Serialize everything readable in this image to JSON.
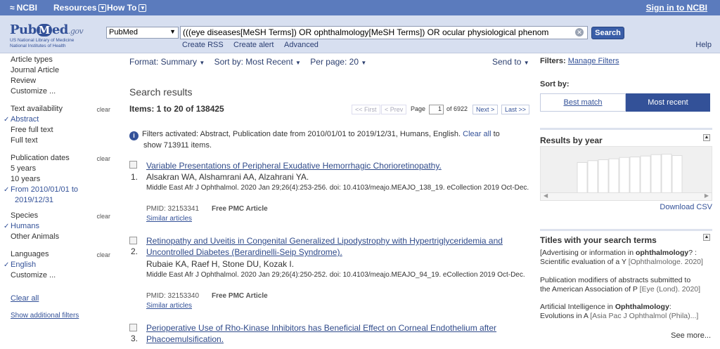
{
  "topbar": {
    "ncbi_label": "NCBI",
    "resources_label": "Resources",
    "howto_label": "How To",
    "signin_label": "Sign in to NCBI"
  },
  "header": {
    "logo_pub": "Pub",
    "logo_m": "M",
    "logo_ed": "ed",
    "logo_gov": ".gov",
    "logo_tagline_1": "US National Library of Medicine",
    "logo_tagline_2": "National Institutes of Health",
    "database_selected": "PubMed",
    "search_query": "(((eye diseases[MeSH Terms]) OR ophthalmology[MeSH Terms]) OR ocular physiological phenom",
    "search_button": "Search",
    "create_rss": "Create RSS",
    "create_alert": "Create alert",
    "advanced": "Advanced",
    "help": "Help"
  },
  "sidebar": {
    "article_types": {
      "heading": "Article types",
      "items": [
        "Journal Article",
        "Review",
        "Customize ..."
      ]
    },
    "text_availability": {
      "heading": "Text availability",
      "clear": "clear",
      "items": [
        "Abstract",
        "Free full text",
        "Full text"
      ]
    },
    "publication_dates": {
      "heading": "Publication dates",
      "clear": "clear",
      "items": [
        "5 years",
        "10 years",
        "From 2010/01/01 to",
        "2019/12/31"
      ]
    },
    "species": {
      "heading": "Species",
      "clear": "clear",
      "items": [
        "Humans",
        "Other Animals"
      ]
    },
    "languages": {
      "heading": "Languages",
      "clear": "clear",
      "items": [
        "English",
        "Customize ..."
      ]
    },
    "clear_all": "Clear all",
    "show_additional": "Show additional filters"
  },
  "toolbar": {
    "format": "Format: Summary",
    "sort": "Sort by: Most Recent",
    "per_page": "Per page: 20",
    "send_to": "Send to"
  },
  "results": {
    "title": "Search results",
    "count": "Items: 1 to 20 of 138425",
    "pager": {
      "first": "<< First",
      "prev": "< Prev",
      "page_label": "Page",
      "page_value": "1",
      "of_pages": "of 6922",
      "next": "Next >",
      "last": "Last >>"
    },
    "filters_note_main": "Filters activated: Abstract, Publication date from 2010/01/01 to 2019/12/31, Humans, English.",
    "filters_clear_all": "Clear all",
    "filters_note_to": "to",
    "filters_note_show": "show 713911 items.",
    "items": [
      {
        "num": "1.",
        "title": "Variable Presentations of Peripheral Exudative Hemorrhagic Chorioretinopathy.",
        "authors": "Alsakran WA, Alshamrani AA, Alzahrani YA.",
        "journal": "Middle East Afr J Ophthalmol. 2020 Jan 29;26(4):253-256. doi: 10.4103/meajo.MEAJO_138_19. eCollection 2019 Oct-Dec.",
        "pmid": "PMID: 32153341",
        "pmc": "Free PMC Article",
        "similar": "Similar articles"
      },
      {
        "num": "2.",
        "title_line1": "Retinopathy and Uveitis in Congenital Generalized Lipodystrophy with Hypertriglyceridemia and",
        "title_line2": "Uncontrolled Diabetes (Berardinelli-Seip Syndrome).",
        "authors": "Rubaie KA, Raef H, Stone DU, Kozak I.",
        "journal": "Middle East Afr J Ophthalmol. 2020 Jan 29;26(4):250-252. doi: 10.4103/meajo.MEAJO_94_19. eCollection 2019 Oct-Dec.",
        "pmid": "PMID: 32153340",
        "pmc": "Free PMC Article",
        "similar": "Similar articles"
      },
      {
        "num": "3.",
        "title_line1": "Perioperative Use of Rho-Kinase Inhibitors has Beneficial Effect on Corneal Endothelium after",
        "title_line2": "Phacoemulsification."
      }
    ]
  },
  "right": {
    "filters_label": "Filters:",
    "manage_filters": "Manage Filters",
    "sort_by_label": "Sort by:",
    "best_match": "Best match",
    "most_recent": "Most recent",
    "results_by_year": "Results by year",
    "download_csv": "Download CSV",
    "titles_heading": "Titles with your search terms",
    "title_items": [
      {
        "pre": "[Advertising or information in ",
        "bold": "ophthalmology",
        "post": "? :",
        "line2": "Scientific evaluation of a Y",
        "src": "[Ophthalmologe. 2020]"
      },
      {
        "pre": "Publication modifiers of abstracts submitted to",
        "bold": "",
        "post": "",
        "line2": "the American Association of P",
        "src": "[Eye (Lond). 2020]"
      },
      {
        "pre": "Artificial Intelligence in ",
        "bold": "Ophthalmology",
        "post": ":",
        "line2": "Evolutions in A",
        "src": "[Asia Pac J Ophthalmol (Phila)...]"
      }
    ],
    "see_more": "See more..."
  },
  "chart_data": {
    "type": "bar",
    "title": "Results by year",
    "values": [
      0,
      0,
      0,
      0,
      0,
      0,
      0,
      0,
      0,
      0,
      0,
      0,
      0,
      0,
      0,
      0,
      0,
      0,
      0,
      0,
      0,
      0,
      0,
      0,
      0,
      0,
      0,
      0,
      0,
      0,
      0,
      0,
      0,
      0,
      0,
      0,
      0,
      0,
      0,
      0,
      0,
      0,
      0,
      0,
      0,
      0,
      0,
      0,
      0,
      0,
      0,
      0,
      0,
      0,
      0,
      0,
      0,
      0,
      0,
      0,
      0,
      0,
      0,
      0,
      0,
      0,
      0,
      0,
      0,
      0,
      0,
      0,
      0,
      0,
      0,
      0,
      0,
      0,
      0,
      0,
      0,
      0,
      0,
      0,
      0,
      0,
      0,
      0,
      0,
      0,
      0,
      0,
      0,
      0,
      0,
      0,
      0,
      0,
      0,
      0,
      0,
      0,
      0,
      0,
      0,
      0,
      0,
      0,
      0,
      0,
      0,
      0,
      0,
      0,
      0,
      0,
      0,
      0,
      0,
      0,
      0,
      0,
      0,
      0,
      0,
      0,
      0,
      0,
      0,
      0,
      0,
      0,
      0,
      0,
      0,
      0,
      0,
      0,
      0,
      0,
      0,
      0,
      0,
      0,
      0,
      0,
      0,
      0,
      0,
      0,
      0,
      0,
      0,
      0,
      0,
      0,
      0,
      0,
      0,
      0,
      0,
      0,
      0,
      0,
      0,
      0,
      0,
      0,
      0,
      0,
      0,
      0,
      0,
      0,
      0,
      0,
      0,
      0,
      0,
      0,
      0,
      0,
      0,
      0,
      0,
      0,
      0,
      0,
      0,
      0,
      0,
      0,
      0,
      0,
      0,
      0,
      0,
      0,
      0,
      0
    ],
    "highlight": [
      0.0,
      0.0,
      0.0,
      0.0,
      0.0,
      0.0,
      0.0,
      0.0,
      0.0,
      0.0,
      0.0,
      0.0,
      0.0,
      0.0,
      0.0,
      0.0,
      0.0,
      0.0,
      0.0,
      0.0,
      0.0,
      0.0,
      0.0,
      0.0,
      0.0,
      0.0,
      0.0,
      0.0,
      0.0,
      0.0,
      0.0,
      0.0,
      0.0,
      0.0,
      0.0,
      0.0,
      0.0,
      0.0,
      0.0,
      0.0
    ],
    "bar_fractions": [
      0.66,
      0.7,
      0.72,
      0.74,
      0.77,
      0.78,
      0.8,
      0.83,
      0.84,
      0.81
    ],
    "ylim": [
      0,
      1
    ]
  }
}
